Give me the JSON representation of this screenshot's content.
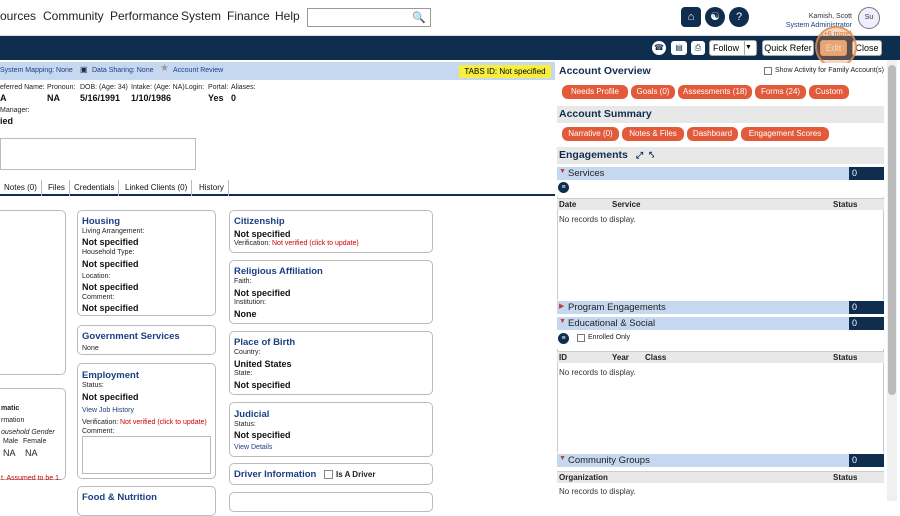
{
  "nav": {
    "menu": [
      "ources",
      "Community",
      "Performance",
      "System",
      "Finance",
      "Help"
    ],
    "user": {
      "name": "Kamish, Scott",
      "role": "System Administrator",
      "more": "(+6 more)",
      "avatar": "Su"
    }
  },
  "toolbar": {
    "follow": "Follow",
    "quick_refer": "Quick Refer",
    "edit": "Edit",
    "close": "Close"
  },
  "infobar": {
    "system_mapping": "System Mapping: None",
    "data_sharing": "Data Sharing: None",
    "account_review": "Account Review",
    "tabs_id": "TABS ID: Not specified"
  },
  "client": {
    "preferred_name_lbl": "eferred Name:",
    "preferred_name": "A",
    "pronoun_lbl": "Pronoun:",
    "pronoun": "NA",
    "dob_lbl": "DOB: (Age: 34)",
    "dob": "5/16/1991",
    "intake_lbl": "Intake: (Age: NA)",
    "intake": "1/10/1986",
    "login_lbl": "Login:",
    "login": "Yes",
    "portal_lbl": "Portal:",
    "portal": "0",
    "aliases_lbl": "Aliases:",
    "manager_lbl": "Manager:",
    "manager": "ied"
  },
  "tabs": [
    "Notes (0)",
    "Files",
    "Credentials",
    "Linked Clients (0)",
    "History"
  ],
  "cards": {
    "housing": {
      "title": "Housing",
      "living_lbl": "Living Arrangement:",
      "living": "Not specified",
      "hh_lbl": "Household Type:",
      "hh": "Not specified",
      "loc_lbl": "Location:",
      "loc": "Not specified",
      "comment_lbl": "Comment:",
      "comment": "Not specified"
    },
    "gov": {
      "title": "Government Services",
      "val": "None"
    },
    "emp": {
      "title": "Employment",
      "status_lbl": "Status:",
      "status": "Not specified",
      "history": "View Job History",
      "verif_lbl": "Verification:",
      "verif": "Not verified (click to update)",
      "comment_lbl": "Comment:"
    },
    "food": {
      "title": "Food & Nutrition"
    },
    "cit": {
      "title": "Citizenship",
      "val": "Not specified",
      "verif_lbl": "Verification:",
      "verif": "Not verified (click to update)"
    },
    "rel": {
      "title": "Religious Affiliation",
      "faith_lbl": "Faith:",
      "faith": "Not specified",
      "inst_lbl": "Institution:",
      "inst": "None"
    },
    "pob": {
      "title": "Place of Birth",
      "country_lbl": "Country:",
      "country": "United States",
      "state_lbl": "State:",
      "state": "Not specified"
    },
    "jud": {
      "title": "Judicial",
      "status_lbl": "Status:",
      "status": "Not specified",
      "details": "View Details"
    },
    "driver": {
      "title": "Driver Information",
      "chk": "Is A Driver"
    },
    "demo": {
      "h1": "matic",
      "h2": "rmation",
      "h3": "ousehold Gender",
      "male": "Male",
      "female": "Female",
      "v1": "NA",
      "v2": "NA",
      "note": "t. Assumed to be 1."
    }
  },
  "right": {
    "overview": {
      "title": "Account Overview",
      "chk": "Show Activity for Family Account(s)",
      "buttons": [
        "Needs Profile",
        "Goals (0)",
        "Assessments (18)",
        "Forms (24)",
        "Custom"
      ]
    },
    "summary": {
      "title": "Account Summary",
      "buttons": [
        "Narrative (0)",
        "Notes & Files",
        "Dashboard",
        "Engagement Scores"
      ]
    },
    "engagements": {
      "title": "Engagements"
    },
    "services": {
      "name": "Services",
      "count": "0",
      "cols": [
        "Date",
        "Service",
        "Status"
      ],
      "empty": "No records to display."
    },
    "program": {
      "name": "Program Engagements",
      "count": "0"
    },
    "edu": {
      "name": "Educational & Social",
      "count": "0",
      "enrolled": "Enrolled Only",
      "cols": [
        "ID",
        "Year",
        "Class",
        "Status"
      ],
      "empty": "No records to display."
    },
    "community": {
      "name": "Community Groups",
      "count": "0",
      "cols": [
        "Organization",
        "Status"
      ],
      "empty": "No records to display."
    }
  },
  "colors": {
    "navy": "#0f2d4f",
    "orange": "#e25a3a",
    "lightblue": "#c5d8ef",
    "yellow": "#f7ee3f"
  }
}
